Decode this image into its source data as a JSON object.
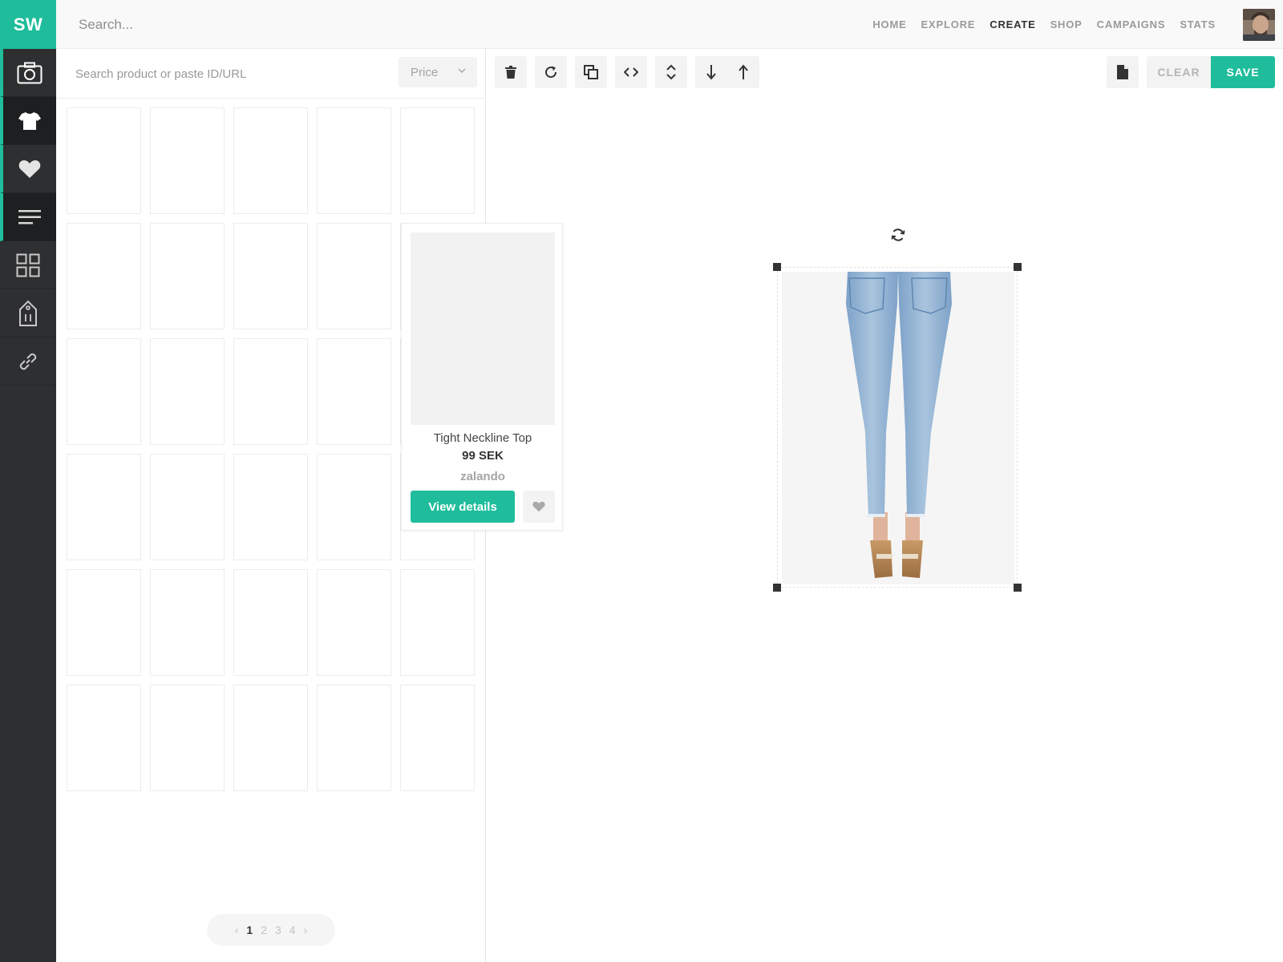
{
  "app": {
    "logo": "SW"
  },
  "header": {
    "search_placeholder": "Search...",
    "nav": [
      {
        "label": "HOME",
        "active": false
      },
      {
        "label": "EXPLORE",
        "active": false
      },
      {
        "label": "CREATE",
        "active": true
      },
      {
        "label": "SHOP",
        "active": false
      },
      {
        "label": "CAMPAIGNS",
        "active": false
      },
      {
        "label": "STATS",
        "active": false
      }
    ]
  },
  "rail": {
    "items": [
      {
        "icon": "camera-icon"
      },
      {
        "icon": "tshirt-icon"
      },
      {
        "icon": "heart-icon"
      },
      {
        "icon": "text-lines-icon"
      },
      {
        "icon": "grid-icon"
      },
      {
        "icon": "price-tag-icon"
      },
      {
        "icon": "link-icon"
      }
    ]
  },
  "products": {
    "search_placeholder": "Search product or paste ID/URL",
    "price_filter": "Price",
    "hover_card": {
      "name": "Tight Neckline Top",
      "price": "99 SEK",
      "brand": "zalando",
      "view_label": "View details"
    },
    "pagination": {
      "prev": "‹",
      "pages": [
        "1",
        "2",
        "3",
        "4"
      ],
      "current": "1",
      "next": "›"
    }
  },
  "toolbar": {
    "clear_label": "CLEAR",
    "save_label": "SAVE"
  },
  "colors": {
    "accent": "#1fbd9b",
    "rail": "#2e2f31"
  }
}
